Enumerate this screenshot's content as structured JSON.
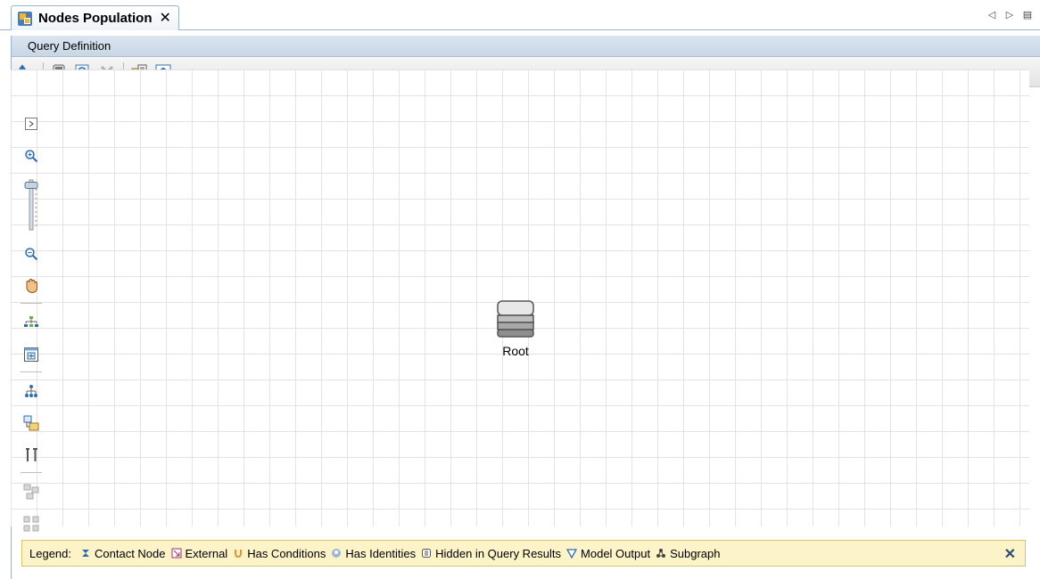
{
  "tab": {
    "title": "Nodes Population",
    "close_glyph": "✕",
    "icon": "query-app-icon"
  },
  "nav": {
    "prev_glyph": "◁",
    "next_glyph": "▷",
    "menu_glyph": "▤"
  },
  "panel": {
    "header": "Query Definition"
  },
  "toolbar": {
    "icons": [
      "layout-arrow-icon",
      "calculator-icon",
      "preview-icon",
      "delete-icon",
      "properties-icon",
      "identity-icon"
    ]
  },
  "side_tools": {
    "icons": [
      "expand-icon",
      "zoom-in-icon",
      "zoom-slider",
      "zoom-out-icon",
      "pan-hand-icon",
      "hierarchy-layout-icon",
      "fit-window-icon",
      "tree-icon",
      "schema-icon",
      "tools-icon",
      "group-icon",
      "ungroup-icon"
    ],
    "zoom_level": 0.05
  },
  "canvas": {
    "node": {
      "label": "Root",
      "icon": "server-node-icon"
    }
  },
  "legend": {
    "title": "Legend:",
    "items": [
      {
        "icon": "contact-node-icon",
        "label": "Contact Node"
      },
      {
        "icon": "external-icon",
        "label": "External"
      },
      {
        "icon": "has-conditions-icon",
        "label": "Has Conditions"
      },
      {
        "icon": "has-identities-icon",
        "label": "Has Identities"
      },
      {
        "icon": "hidden-icon",
        "label": "Hidden in Query Results"
      },
      {
        "icon": "model-output-icon",
        "label": "Model Output"
      },
      {
        "icon": "subgraph-icon",
        "label": "Subgraph"
      }
    ],
    "close_glyph": "✕"
  },
  "colors": {
    "legend_bg": "#fdf3c8",
    "header_bg": "#c8d6e5",
    "grid_line": "#e3e3e3"
  }
}
